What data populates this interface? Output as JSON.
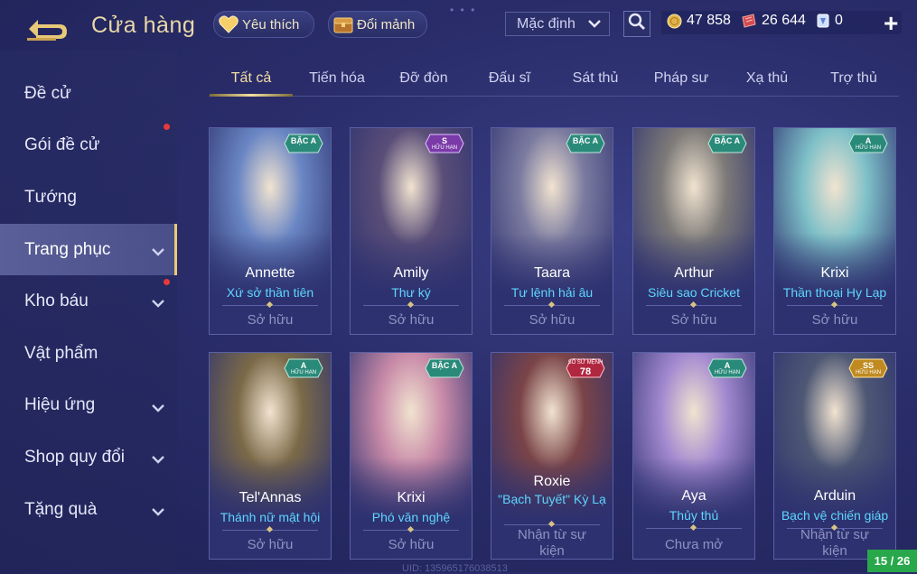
{
  "header": {
    "back_icon": "back-arrow-icon",
    "title": "Cửa hàng",
    "favorites_label": "Yêu thích",
    "exchange_label": "Đổi mảnh",
    "sort_value": "Mặc định",
    "currencies": [
      {
        "name": "gold-coin-icon",
        "value": "47 858"
      },
      {
        "name": "voucher-icon",
        "value": "26 644"
      },
      {
        "name": "diamond-icon",
        "value": "0"
      }
    ]
  },
  "sidebar": {
    "items": [
      {
        "label": "Đề cử"
      },
      {
        "label": "Gói đề cử"
      },
      {
        "label": "Tướng"
      },
      {
        "label": "Trang phục"
      },
      {
        "label": "Kho báu"
      },
      {
        "label": "Vật phẩm"
      },
      {
        "label": "Hiệu ứng"
      },
      {
        "label": "Shop quy đổi"
      },
      {
        "label": "Tặng quà"
      }
    ]
  },
  "tabs": [
    "Tất cả",
    "Tiến hóa",
    "Đỡ đòn",
    "Đấu sĩ",
    "Sát thủ",
    "Pháp sư",
    "Xạ thủ",
    "Trợ thủ"
  ],
  "cards": [
    {
      "hero": "Annette",
      "skin": "Xứ sở thần tiên",
      "status": "Sở hữu",
      "badge": "BẬC A",
      "badge_sub": "",
      "color": "#6a86c4"
    },
    {
      "hero": "Amily",
      "skin": "Thư ký",
      "status": "Sở hữu",
      "badge": "S",
      "badge_sub": "HỮU HẠN",
      "color": "#5a4e78"
    },
    {
      "hero": "Taara",
      "skin": "Tư lệnh hải âu",
      "status": "Sở hữu",
      "badge": "BẬC A",
      "badge_sub": "",
      "color": "#7b7ba0"
    },
    {
      "hero": "Arthur",
      "skin": "Siêu sao Cricket",
      "status": "Sở hữu",
      "badge": "BẬC A",
      "badge_sub": "",
      "color": "#7d7a78"
    },
    {
      "hero": "Krixi",
      "skin": "Thần thoại Hy Lạp",
      "status": "Sở hữu",
      "badge": "A",
      "badge_sub": "HỮU HẠN",
      "color": "#7ec0c8"
    },
    {
      "hero": "Tel'Annas",
      "skin": "Thánh nữ mật hội",
      "status": "Sở hữu",
      "badge": "A",
      "badge_sub": "HỮU HẠN",
      "color": "#7b6a48"
    },
    {
      "hero": "Krixi",
      "skin": "Phó văn nghệ",
      "status": "Sở hữu",
      "badge": "BẬC A",
      "badge_sub": "",
      "color": "#c88aa8"
    },
    {
      "hero": "Roxie",
      "skin": "\"Bạch Tuyết\" Kỳ Lạ",
      "status": "Nhận từ sự kiện",
      "badge": "78",
      "badge_sub": "SỐ SỨ MỆNH",
      "color": "#7a4448"
    },
    {
      "hero": "Aya",
      "skin": "Thủy thủ",
      "status": "Chưa mở",
      "badge": "A",
      "badge_sub": "HỮU HẠN",
      "color": "#a48ad0"
    },
    {
      "hero": "Arduin",
      "skin": "Bạch vệ chiến giáp",
      "status": "Nhận từ sự kiện",
      "badge": "SS",
      "badge_sub": "HỮU HẠN",
      "color": "#4e5874"
    }
  ],
  "footer": {
    "uid": "UID: 135965176038513",
    "page": "15 / 26"
  },
  "colors": {
    "background": "#2a2d6a",
    "gold_text": "#e9d8a8",
    "skin_name": "#5ed6ff",
    "page_badge": "#28a84a"
  }
}
